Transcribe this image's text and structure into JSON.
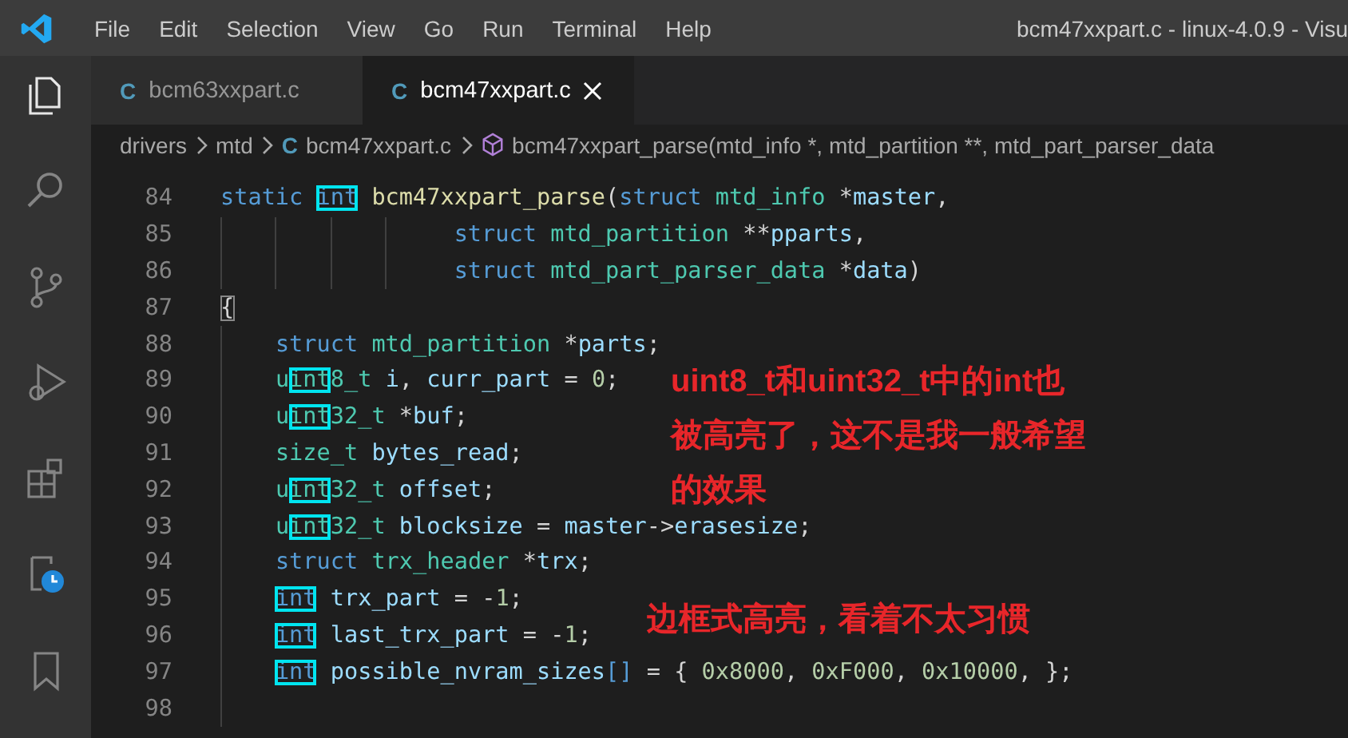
{
  "menu": [
    "File",
    "Edit",
    "Selection",
    "View",
    "Go",
    "Run",
    "Terminal",
    "Help"
  ],
  "window": {
    "title": "bcm47xxpart.c - linux-4.0.9 - Visu"
  },
  "activity_bar": [
    {
      "kind": "files",
      "selected": true
    },
    {
      "kind": "search",
      "selected": false
    },
    {
      "kind": "source_control",
      "selected": false
    },
    {
      "kind": "run_debug",
      "selected": false
    },
    {
      "kind": "extensions",
      "selected": false
    },
    {
      "kind": "timeline",
      "selected": false
    },
    {
      "kind": "bookmark",
      "selected": false
    }
  ],
  "tabs": [
    {
      "icon": "C",
      "label": "bcm63xxpart.c",
      "selected": false
    },
    {
      "icon": "C",
      "label": "bcm47xxpart.c",
      "selected": true
    }
  ],
  "breadcrumb": [
    {
      "kind": "folder",
      "text": "drivers"
    },
    {
      "kind": "folder",
      "text": "mtd"
    },
    {
      "kind": "file",
      "icon": "C",
      "text": "bcm47xxpart.c"
    },
    {
      "kind": "symbol",
      "text": "bcm47xxpart_parse(mtd_info *, mtd_partition **, mtd_part_parser_data"
    }
  ],
  "code_lines": [
    {
      "number": "84",
      "tokens": [
        {
          "text": "static ",
          "kind": "keyword",
          "boxed": false
        },
        {
          "text": "int",
          "kind": "keyword",
          "boxed": true
        },
        {
          "text": " bcm47xxpart_parse",
          "kind": "function",
          "boxed": false
        },
        {
          "text": "(",
          "kind": "plain",
          "boxed": false
        },
        {
          "text": "struct ",
          "kind": "keyword",
          "boxed": false
        },
        {
          "text": "mtd_info",
          "kind": "type",
          "boxed": false
        },
        {
          "text": " *",
          "kind": "plain",
          "boxed": false
        },
        {
          "text": "master",
          "kind": "variable",
          "boxed": false
        },
        {
          "text": ",",
          "kind": "plain",
          "boxed": false
        }
      ]
    },
    {
      "number": "85",
      "tokens": [
        {
          "text": "                 struct ",
          "kind": "keyword",
          "boxed": false
        },
        {
          "text": "mtd_partition",
          "kind": "type",
          "boxed": false
        },
        {
          "text": " **",
          "kind": "plain",
          "boxed": false
        },
        {
          "text": "pparts",
          "kind": "variable",
          "boxed": false
        },
        {
          "text": ",",
          "kind": "plain",
          "boxed": false
        }
      ]
    },
    {
      "number": "86",
      "tokens": [
        {
          "text": "                 struct ",
          "kind": "keyword",
          "boxed": false
        },
        {
          "text": "mtd_part_parser_data",
          "kind": "type",
          "boxed": false
        },
        {
          "text": " *",
          "kind": "plain",
          "boxed": false
        },
        {
          "text": "data",
          "kind": "variable",
          "boxed": false
        },
        {
          "text": ")",
          "kind": "plain",
          "boxed": false
        }
      ]
    },
    {
      "number": "87",
      "tokens": [
        {
          "text": "{",
          "kind": "matched_brace",
          "boxed": false
        }
      ]
    },
    {
      "number": "88",
      "tokens": [
        {
          "text": "    struct ",
          "kind": "keyword",
          "boxed": false
        },
        {
          "text": "mtd_partition",
          "kind": "type",
          "boxed": false
        },
        {
          "text": " *",
          "kind": "plain",
          "boxed": false
        },
        {
          "text": "parts",
          "kind": "variable",
          "boxed": false
        },
        {
          "text": ";",
          "kind": "plain",
          "boxed": false
        }
      ]
    },
    {
      "number": "89",
      "tokens": [
        {
          "text": "    u",
          "kind": "type",
          "boxed": false
        },
        {
          "text": "int",
          "kind": "type",
          "boxed": true
        },
        {
          "text": "8_t",
          "kind": "type",
          "boxed": false
        },
        {
          "text": " i",
          "kind": "variable",
          "boxed": false
        },
        {
          "text": ", ",
          "kind": "plain",
          "boxed": false
        },
        {
          "text": "curr_part",
          "kind": "variable",
          "boxed": false
        },
        {
          "text": " = ",
          "kind": "plain",
          "boxed": false
        },
        {
          "text": "0",
          "kind": "number",
          "boxed": false
        },
        {
          "text": ";",
          "kind": "plain",
          "boxed": false
        }
      ]
    },
    {
      "number": "90",
      "tokens": [
        {
          "text": "    u",
          "kind": "type",
          "boxed": false
        },
        {
          "text": "int",
          "kind": "type",
          "boxed": true
        },
        {
          "text": "32_t",
          "kind": "type",
          "boxed": false
        },
        {
          "text": " *",
          "kind": "plain",
          "boxed": false
        },
        {
          "text": "buf",
          "kind": "variable",
          "boxed": false
        },
        {
          "text": ";",
          "kind": "plain",
          "boxed": false
        }
      ]
    },
    {
      "number": "91",
      "tokens": [
        {
          "text": "    size_t",
          "kind": "type",
          "boxed": false
        },
        {
          "text": " bytes_read",
          "kind": "variable",
          "boxed": false
        },
        {
          "text": ";",
          "kind": "plain",
          "boxed": false
        }
      ]
    },
    {
      "number": "92",
      "tokens": [
        {
          "text": "    u",
          "kind": "type",
          "boxed": false
        },
        {
          "text": "int",
          "kind": "type",
          "boxed": true
        },
        {
          "text": "32_t",
          "kind": "type",
          "boxed": false
        },
        {
          "text": " offset",
          "kind": "variable",
          "boxed": false
        },
        {
          "text": ";",
          "kind": "plain",
          "boxed": false
        }
      ]
    },
    {
      "number": "93",
      "tokens": [
        {
          "text": "    u",
          "kind": "type",
          "boxed": false
        },
        {
          "text": "int",
          "kind": "type",
          "boxed": true
        },
        {
          "text": "32_t",
          "kind": "type",
          "boxed": false
        },
        {
          "text": " blocksize",
          "kind": "variable",
          "boxed": false
        },
        {
          "text": " = ",
          "kind": "plain",
          "boxed": false
        },
        {
          "text": "master",
          "kind": "variable",
          "boxed": false
        },
        {
          "text": "->",
          "kind": "plain",
          "boxed": false
        },
        {
          "text": "erasesize",
          "kind": "variable",
          "boxed": false
        },
        {
          "text": ";",
          "kind": "plain",
          "boxed": false
        }
      ]
    },
    {
      "number": "94",
      "tokens": [
        {
          "text": "    struct ",
          "kind": "keyword",
          "boxed": false
        },
        {
          "text": "trx_header",
          "kind": "type",
          "boxed": false
        },
        {
          "text": " *",
          "kind": "plain",
          "boxed": false
        },
        {
          "text": "trx",
          "kind": "variable",
          "boxed": false
        },
        {
          "text": ";",
          "kind": "plain",
          "boxed": false
        }
      ]
    },
    {
      "number": "95",
      "tokens": [
        {
          "text": "    int",
          "kind": "keyword",
          "boxed": true
        },
        {
          "text": " trx_part",
          "kind": "variable",
          "boxed": false
        },
        {
          "text": " = -",
          "kind": "plain",
          "boxed": false
        },
        {
          "text": "1",
          "kind": "number",
          "boxed": false
        },
        {
          "text": ";",
          "kind": "plain",
          "boxed": false
        }
      ]
    },
    {
      "number": "96",
      "tokens": [
        {
          "text": "    int",
          "kind": "keyword",
          "boxed": true
        },
        {
          "text": " last_trx_part",
          "kind": "variable",
          "boxed": false
        },
        {
          "text": " = -",
          "kind": "plain",
          "boxed": false
        },
        {
          "text": "1",
          "kind": "number",
          "boxed": false
        },
        {
          "text": ";",
          "kind": "plain",
          "boxed": false
        }
      ]
    },
    {
      "number": "97",
      "tokens": [
        {
          "text": "    int",
          "kind": "keyword",
          "boxed": true
        },
        {
          "text": " possible_nvram_sizes",
          "kind": "variable",
          "boxed": false
        },
        {
          "text": "[]",
          "kind": "bracket",
          "boxed": false
        },
        {
          "text": " = { ",
          "kind": "plain",
          "boxed": false
        },
        {
          "text": "0x8000",
          "kind": "number",
          "boxed": false
        },
        {
          "text": ", ",
          "kind": "plain",
          "boxed": false
        },
        {
          "text": "0xF000",
          "kind": "number",
          "boxed": false
        },
        {
          "text": ", ",
          "kind": "plain",
          "boxed": false
        },
        {
          "text": "0x10000",
          "kind": "number",
          "boxed": false
        },
        {
          "text": ", };",
          "kind": "plain",
          "boxed": false
        }
      ]
    },
    {
      "number": "98"
    }
  ],
  "annotations": [
    {
      "text": "uint8_t和uint32_t中的int也被高亮了，这不是我一般希望的效果"
    },
    {
      "text": "边框式高亮，看着不太习惯"
    }
  ]
}
